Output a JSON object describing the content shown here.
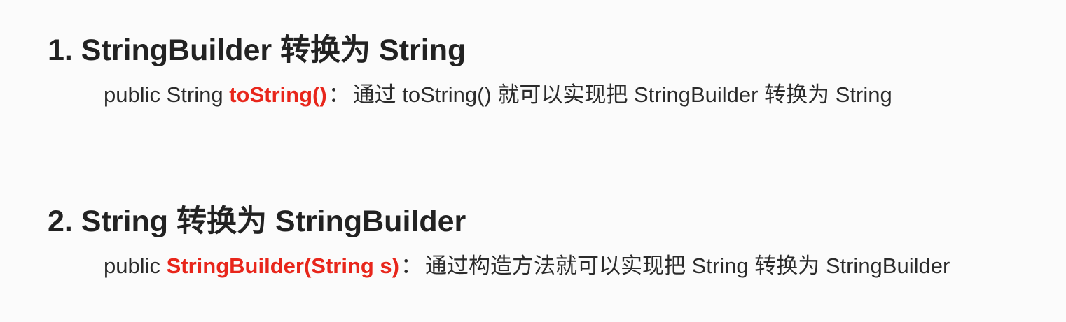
{
  "sections": [
    {
      "heading": "1. StringBuilder 转换为 String",
      "prefix": "public String ",
      "method": "toString()",
      "separator": "：",
      "description": "通过 toString() 就可以实现把 StringBuilder 转换为 String"
    },
    {
      "heading": "2. String 转换为 StringBuilder",
      "prefix": "public ",
      "method": "StringBuilder(String s)",
      "separator": "：",
      "description": "通过构造方法就可以实现把 String 转换为 StringBuilder"
    }
  ],
  "colors": {
    "background": "#fbfbfb",
    "heading": "#222222",
    "text": "#2b2b2b",
    "method_highlight": "#e8261b"
  }
}
